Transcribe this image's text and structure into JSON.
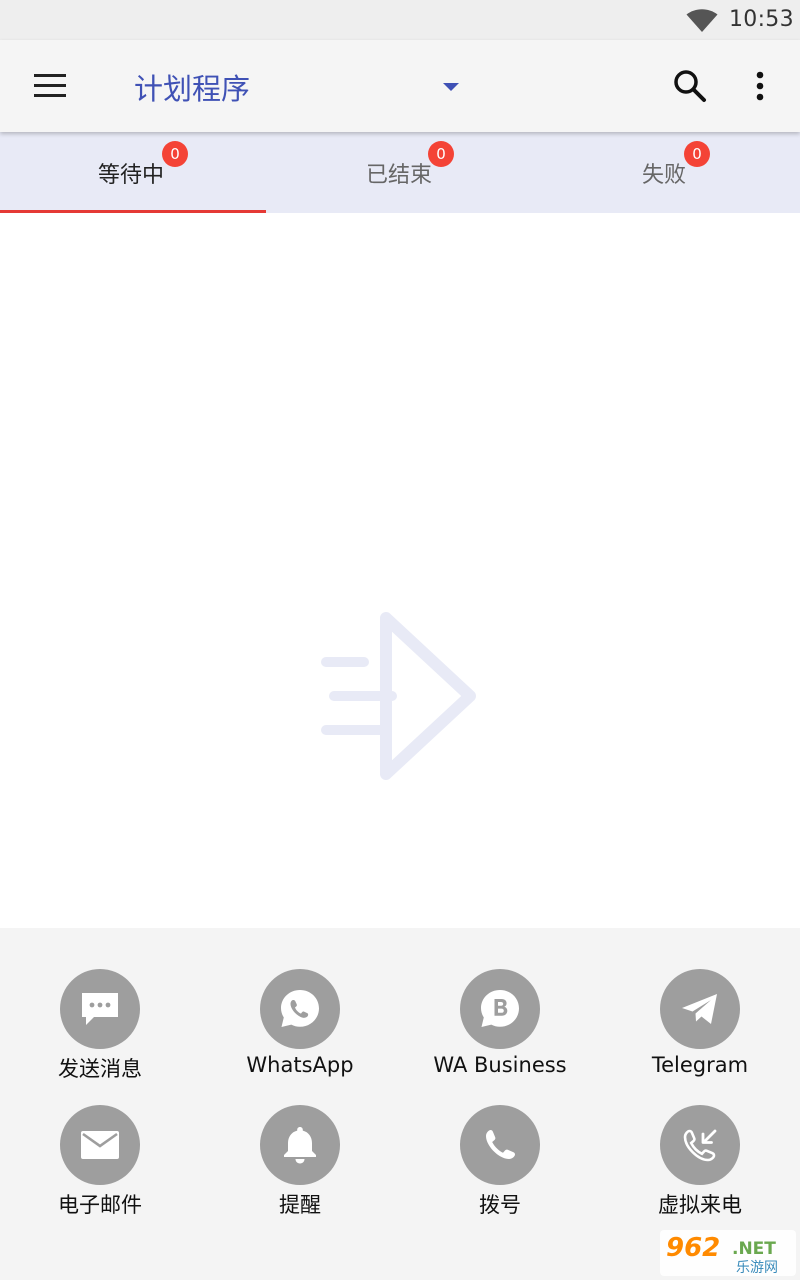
{
  "status_bar": {
    "time": "10:53",
    "wifi_icon": "wifi-icon"
  },
  "app_bar": {
    "title": "计划程序",
    "menu_icon": "hamburger-menu-icon",
    "dropdown_icon": "caret-down-icon",
    "search_icon": "search-icon",
    "more_icon": "more-vertical-icon"
  },
  "tabs": [
    {
      "label": "等待中",
      "count": "0",
      "active": true
    },
    {
      "label": "已结束",
      "count": "0",
      "active": false
    },
    {
      "label": "失败",
      "count": "0",
      "active": false
    }
  ],
  "colors": {
    "accent": "#3f51b5",
    "badge": "#f44336",
    "tab_indicator": "#e53935",
    "tab_bg": "#e8eaf6",
    "action_circle": "#9e9e9e"
  },
  "empty_state": {
    "icon": "send-arrow-icon"
  },
  "actions": [
    {
      "label": "发送消息",
      "icon": "chat-bubble-icon"
    },
    {
      "label": "WhatsApp",
      "icon": "whatsapp-icon"
    },
    {
      "label": "WA Business",
      "icon": "whatsapp-business-icon"
    },
    {
      "label": "Telegram",
      "icon": "telegram-icon"
    },
    {
      "label": "电子邮件",
      "icon": "email-icon"
    },
    {
      "label": "提醒",
      "icon": "bell-icon"
    },
    {
      "label": "拨号",
      "icon": "phone-icon"
    },
    {
      "label": "虚拟来电",
      "icon": "incoming-call-icon"
    }
  ],
  "watermark": {
    "brand": "962",
    "suffix": ".NET",
    "tagline": "乐游网"
  }
}
